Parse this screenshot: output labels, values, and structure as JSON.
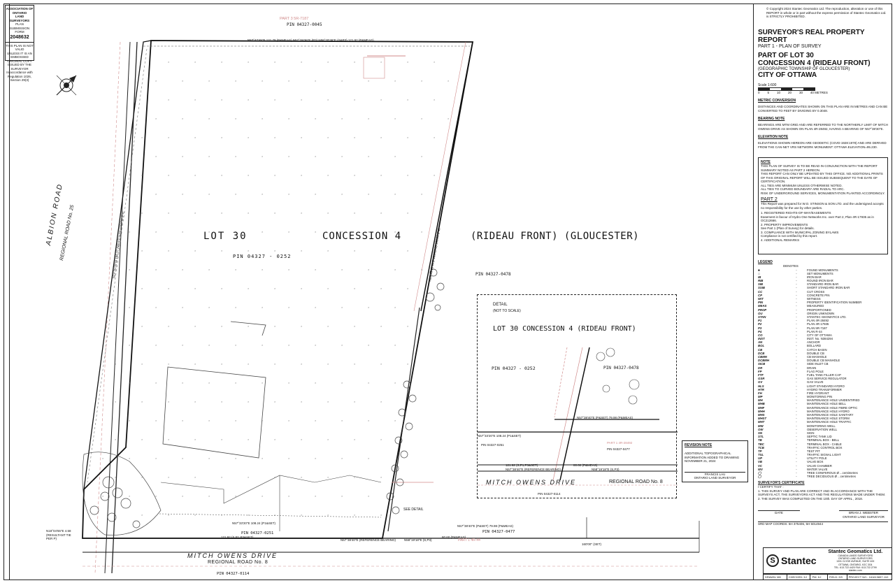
{
  "stamp": {
    "lines": [
      "ASSOCIATION OF ONTARIO",
      "LAND SURVEYORS",
      "PLAN SUBMISSION FORM"
    ],
    "number": "2048632",
    "notice": [
      "THIS PLAN IS NOT VALID",
      "UNLESS IT IS AN EMBOSSED",
      "ORIGINAL COPY",
      "ISSUED BY THE SURVEYOR",
      "In accordance with",
      "Regulation 1026, Section 29(3)"
    ]
  },
  "copyright": [
    "© Copyright 2024 Stantec Geomatics Ltd. The reproduction, alteration or use of this",
    "REPORT in whole or in part without the express permission of Stantec Geomatics Ltd.",
    "is STRICTLY PROHIBITED."
  ],
  "title": {
    "heading": "SURVEYOR'S REAL PROPERTY REPORT",
    "part": "PART 1 - PLAN OF SURVEY",
    "of": "PART OF LOT 30",
    "concession": "CONCESSION 4 (RIDEAU FRONT)",
    "township": "(GEOGRAPHIC TOWNSHIP OF GLOUCESTER)",
    "city": "CITY OF OTTAWA",
    "scale": "Scale 1:600",
    "scale_ticks": [
      "0",
      "5",
      "10",
      "20",
      "30",
      "40 METRES"
    ]
  },
  "notes_right": [
    {
      "heading": "METRIC CONVERSION",
      "text": "DISTANCES AND COORDINATES SHOWN ON THIS PLAN ARE IN METRES AND CAN BE CONVERTED TO FEET BY DIVIDING BY 0.3048."
    },
    {
      "heading": "BEARING NOTE",
      "text": "BEARINGS ARE MTM GRID AND ARE REFERRED TO THE NORTHERLY LIMIT OF MITCH OWENS DRIVE AS SHOWN ON PLAN 4R-28492, HAVING A BEARING OF N57°38'30\"E."
    },
    {
      "heading": "ELEVATION NOTE",
      "text": "ELEVATIONS SHOWN HEREON ARE GEODETIC (CGVD-1928:1978) AND ARE DERIVED FROM THE CAN-NET VRS NETWORK MONUMENT: OTTAWA ELEVATION=95.230."
    }
  ],
  "note_box": {
    "heading": "NOTE",
    "lines": [
      "THIS PLAN OF SURVEY IS TO BE READ IN CONJUNCTION WITH THE REPORT SUMMARY NOTED AS PART 2 HEREON.",
      "THIS REPORT CAN ONLY BE UPDATED BY THIS OFFICE. NO ADDITIONAL PRINTS OF THIS ORIGINAL REPORT WILL BE ISSUED SUBSEQUENT TO THE DATE OF CERTIFICATION.",
      "ALL TIES ARE MINIMUM UNLESS OTHERWISE NOTED.",
      "ALL TIES TO CURVED BOUNDARY ARE RADIAL TO ARC.",
      "RISK OF UNDERGROUND SERVICES, MONUMENTATION PLANTED ACCORDINGLY."
    ],
    "part2": "PART 2",
    "part2_text": "This Report was prepared for W.O. STINSON & SON LTD. and the undersigned accepts no responsibility for the use by other parties.",
    "items": [
      "1.  REGISTERED RIGHTS-OF-WAY/EASEMENTS",
      "Easement in favour of Hydro One Networks Inc. over Part 2, Plan 4R-17935 as in OC212666.",
      "2.  PROPERTY IMPROVEMENTS",
      "See Part 1 (Plan of Survey) for details.",
      "3.  COMPLIANCE WITH MUNICIPAL ZONING BYLAWS",
      "Compliance is not certified by this report.",
      "4.  ADDITIONAL REMARKS"
    ]
  },
  "legend": {
    "heading": "LEGEND",
    "denotes": "DENOTES",
    "rows": [
      [
        "■",
        "FOUND MONUMENTS"
      ],
      [
        "□",
        "SET MONUMENTS"
      ],
      [
        "IB",
        "IRON BAR"
      ],
      [
        "RIB",
        "ROUND IRON BAR"
      ],
      [
        "SIB",
        "STANDARD IRON BAR"
      ],
      [
        "SSIB",
        "SHORT STANDARD IRON BAR"
      ],
      [
        "CC",
        "CUT CROSS"
      ],
      [
        "CP",
        "CONCRETE PIN"
      ],
      [
        "WIT",
        "WITNESS"
      ],
      [
        "PIN",
        "PROPERTY IDENTIFICATION NUMBER"
      ],
      [
        "MEAS",
        "MEASURED"
      ],
      [
        "PROP",
        "PROPORTIONED"
      ],
      [
        "OU",
        "ORIGIN UNKNOWN"
      ],
      [
        "STAN",
        "STANTEC GEOMATICS LTD."
      ],
      [
        "P1",
        "PLAN 4R-28492"
      ],
      [
        "P2",
        "PLAN 4R-17935"
      ],
      [
        "P3",
        "PLAN 5R-7187"
      ],
      [
        "P4",
        "PLAN R-44"
      ],
      [
        "CO",
        "CITY OF OTTAWA"
      ],
      [
        "INST",
        "INST. No. N384294"
      ],
      [
        "AN",
        "ANCHOR"
      ],
      [
        "BOL",
        "BOLLARD"
      ],
      [
        "CB",
        "CATCH BASIN"
      ],
      [
        "DCB",
        "DOUBLE CB"
      ],
      [
        "CBMH",
        "CB MANHOLE"
      ],
      [
        "DCBMH",
        "DOUBLE CB MANHOLE"
      ],
      [
        "SICB",
        "SIDE INLET CB"
      ],
      [
        "DR",
        "DRAIN"
      ],
      [
        "FP",
        "FLAG POLE"
      ],
      [
        "FTF",
        "FUEL TANK FILLER CAP"
      ],
      [
        "GSR",
        "GAS SERVICE REGULATOR"
      ],
      [
        "GV",
        "GAS VALVE"
      ],
      [
        "HLS",
        "LIGHT STANDARD HYDRO"
      ],
      [
        "HTR",
        "HYDRO TRANSFORMER"
      ],
      [
        "FH",
        "FIRE HYDRANT"
      ],
      [
        "MP",
        "MONITORING PIN"
      ],
      [
        "MH",
        "MAINTENANCE HOLE UNIDENTIFIED"
      ],
      [
        "MHB",
        "MAINTENANCE HOLE BELL"
      ],
      [
        "MHF",
        "MAINTENANCE HOLE FIBRE OPTIC"
      ],
      [
        "MHH",
        "MAINTENANCE HOLE HYDRO"
      ],
      [
        "MHS",
        "MAINTENANCE HOLE SANITARY"
      ],
      [
        "MHST",
        "MAINTENANCE HOLE STORM"
      ],
      [
        "MHT",
        "MAINTENANCE HOLE TRAFFIC"
      ],
      [
        "MW",
        "MONITORING WELL"
      ],
      [
        "OW",
        "OBSERVATION WELL"
      ],
      [
        "SN",
        "SIGN"
      ],
      [
        "STL",
        "SEPTIC TANK LID"
      ],
      [
        "TB",
        "TERMINAL BOX - BELL"
      ],
      [
        "TBC",
        "TERMINAL BOX - CABLE"
      ],
      [
        "TCB",
        "TRAFFIC CONTROL BOX"
      ],
      [
        "TP",
        "TEST PIT"
      ],
      [
        "TSL",
        "TRAFFIC SIGNAL LIGHT"
      ],
      [
        "UP",
        "UTILITY POLE"
      ],
      [
        "VB",
        "VALVE BOX"
      ],
      [
        "VC",
        "VALVE CHAMBER"
      ],
      [
        "WV",
        "WATER VALVE"
      ],
      [
        "◯",
        "TREE CONIFEROUS Ø ...centimetres"
      ],
      [
        "◯",
        "TREE DECIDUOUS Ø ...centimetres"
      ]
    ]
  },
  "certificate": {
    "heading": "SURVEYOR'S CERTIFICATE",
    "lines": [
      "I CERTIFY THAT :",
      "1.  THIS SURVEY AND PLAN ARE CORRECT AND IN ACCORDANCE WITH THE SURVEYS ACT, THE SURVEYORS ACT AND THE REGULATIONS MADE UNDER THEM.",
      "2.  THE SURVEY WAS COMPLETED ON THE 10th. DAY OF APRIL , 2018."
    ],
    "date_label": "DATE",
    "signer": "BRIAN J. WEBSTER",
    "signer_title": "ONTARIO LAND SURVEYOR",
    "srd": "SRD MAP COORDS: 5H 375406, 5H 5014944"
  },
  "company": {
    "logo": "Stantec",
    "name": "Stantec Geomatics Ltd.",
    "address": [
      "CANADA LANDS SURVEYORS",
      "ONTARIO LAND SURVEYORS",
      "1331 CLYDE AVENUE, SUITE 400",
      "OTTAWA, ONTARIO, K2C 3G4",
      "TEL: 613.722.4420  FAX: 613.722.2799",
      "stantec.com"
    ],
    "drawn_label": "DRAWN: MK",
    "checked_label": "CHECKED: KJ",
    "pm_label": "PM: KJ",
    "field_label": "FIELD: DS",
    "project_label": "PROJECT NO.: 161613657-110"
  },
  "revision": {
    "heading": "REVISION NOTE",
    "text": "ADDITIONAL TOPOGRAPHICAL INFORMATION ADDED TO DRAWING NOVEMBER 21, 2024",
    "signer": "FRANCIS LAU",
    "signer_title": "ONTARIO LAND SURVEYOR"
  },
  "detail": {
    "heading": "DETAIL",
    "sub": "(NOT TO SCALE)",
    "title": "LOT 30 CONCESSION 4 (RIDEAU FRONT)",
    "pin_left": "PIN  04327 - 0252",
    "pin_right": "PIN 04327-0478",
    "bearing1": "N57°38'40\"E (P&SET)  79.98 (P&MEAS)",
    "bearing2": "N57°33'20\"E  108.24 (P1&SET)",
    "pin_251": "PIN 04327-0251",
    "pin_477": "PIN 04327-0477",
    "dist1": "121.92 (S,P1,P3&SET)",
    "dist2": "80.60 (P&MEAS)",
    "ref": "N57°38'40\"E (REFERENCE BEARING)",
    "b3": "N58°19'18\"E (S,P3)",
    "road": "MITCH OWENS DRIVE",
    "road_sub": "REGIONAL ROAD No. 8",
    "pin_114": "PIN 04327-0114",
    "part1": "PART 1  4R-28492"
  },
  "plan": {
    "lot_label": "LOT  30",
    "concession_label": "CONCESSION 4",
    "rideau_label": "(RIDEAU FRONT) (GLOUCESTER)",
    "pin_main": "PIN  04327  -  0252",
    "pin_top": "PIN 04327-0045",
    "pin_right": "PIN 04327-0478",
    "pin_bottom_left": "PIN 04327-0251",
    "pin_bottom_right": "PIN 04327-0477",
    "pin_road": "PIN 04327-0114",
    "road_name": "MITCH OWENS DRIVE",
    "road_sub": "REGIONAL ROAD No. 8",
    "albion": "ALBION ROAD",
    "albion_sub": "REGIONAL ROAD No. 25",
    "part3": "PART 3  5R-7187",
    "top_bearing": "N57°47'45\"E  121.79 (P&MEAS) N57°29'36\"E (P3)  N58°20'36\"E (S&P3)  121.92 (P&MEAS)",
    "left_bearing": "N23°20'20\"W 186.37 (MEAS) N23°27'50\"W (P1)",
    "right_bearing": "N23°29'40\"W (P1&MEAS) 186.22 (P1)",
    "bottom_bearing": "N57°33'20\"E  108.24 (P1&SET)",
    "bottom_dist": "121.92 (S,P1,P3&SET)",
    "bottom_b2": "N57°38'40\"E (P&SET) 79.98 (P&MEAS)",
    "bottom_ref": "N57°38'40\"E (REFERENCE BEARING)",
    "bottom_b3": "N58°19'18\"E (S,P3)",
    "bottom_d2": "80.60 (P&MEAS)",
    "tie": "N18°04'55\"E 4.58 (RESULTANT TIE PER P)",
    "see_detail": "SEE DETAIL",
    "part1": "PART 1  4R-44",
    "set": "160'00\" (SET)"
  },
  "colors": {
    "ink": "#1a1a1a",
    "red": "#d08a8a",
    "grid": "#999999"
  }
}
